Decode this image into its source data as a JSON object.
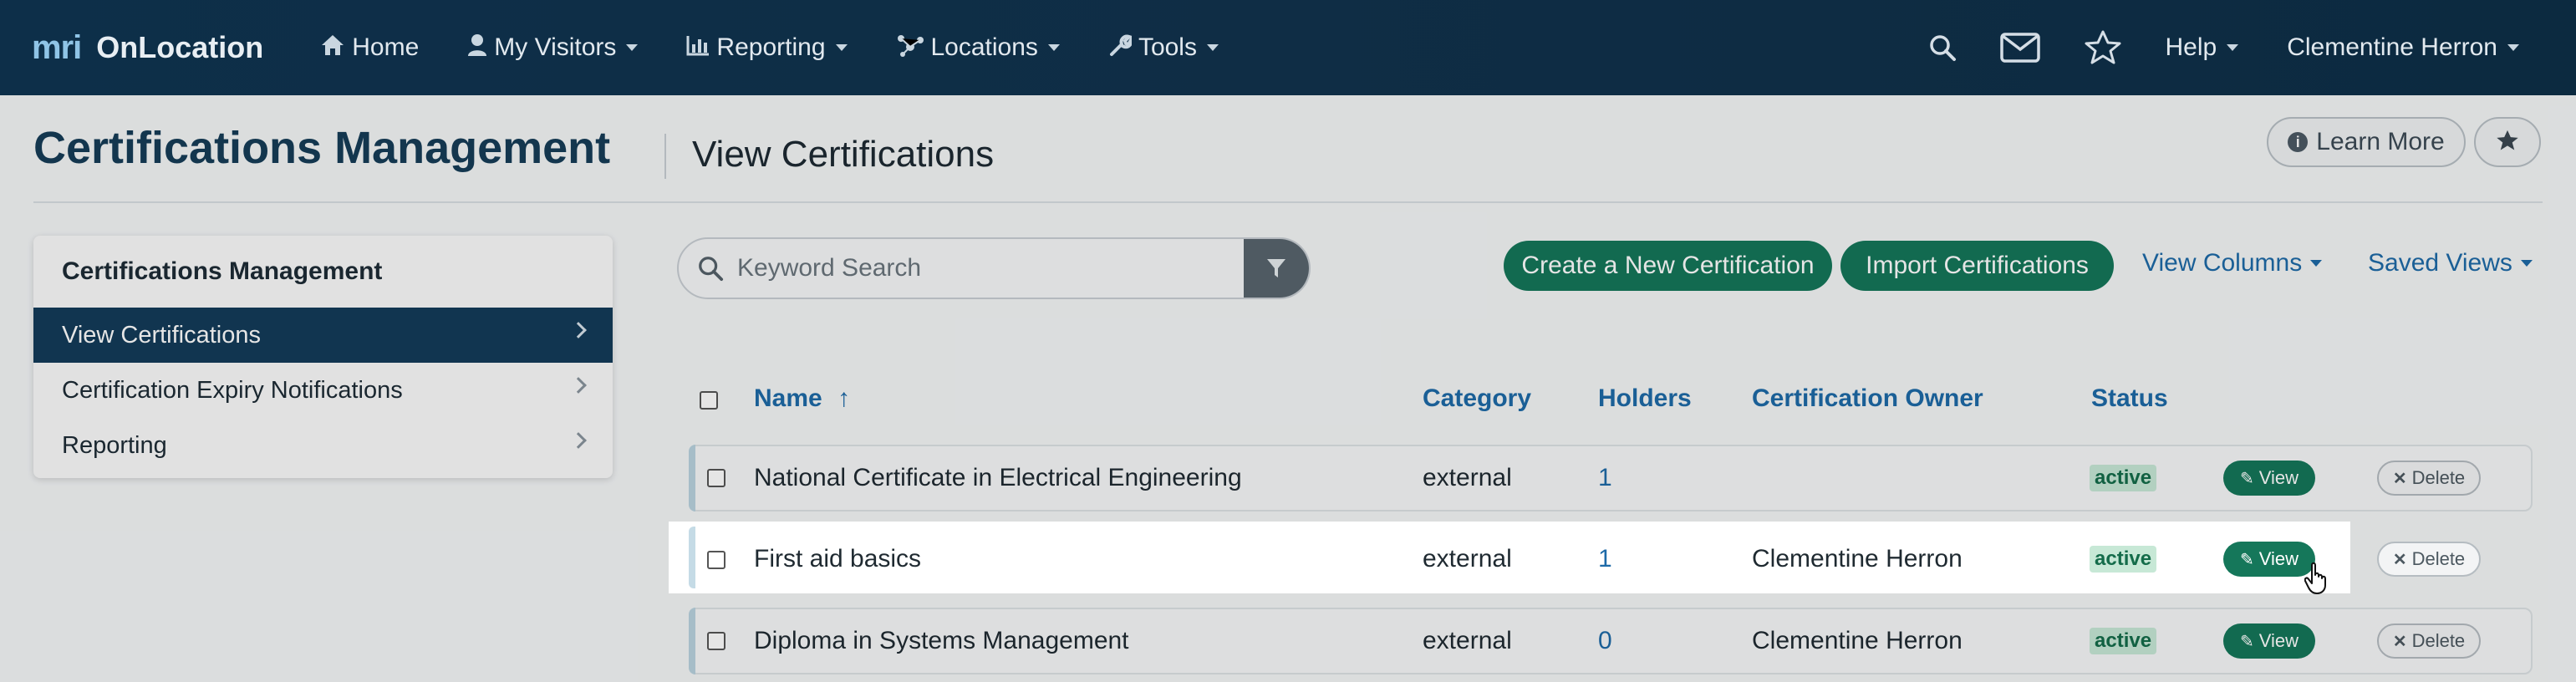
{
  "navbar": {
    "brand_mark": "mri",
    "brand_name": "OnLocation",
    "items": [
      {
        "label": "Home",
        "icon": "home-icon"
      },
      {
        "label": "My Visitors",
        "icon": "user-icon"
      },
      {
        "label": "Reporting",
        "icon": "bar-chart-icon"
      },
      {
        "label": "Locations",
        "icon": "network-icon"
      },
      {
        "label": "Tools",
        "icon": "wrench-icon"
      }
    ],
    "help_label": "Help",
    "user_name": "Clementine Herron"
  },
  "page": {
    "title": "Certifications Management",
    "subtitle": "View Certifications",
    "learn_more_label": "Learn More"
  },
  "sidebar": {
    "heading": "Certifications Management",
    "items": [
      {
        "label": "View Certifications",
        "active": true
      },
      {
        "label": "Certification Expiry Notifications",
        "active": false
      },
      {
        "label": "Reporting",
        "active": false
      }
    ]
  },
  "toolbar": {
    "search_placeholder": "Keyword Search",
    "create_label": "Create a New Certification",
    "import_label": "Import Certifications",
    "view_columns_label": "View Columns",
    "saved_views_label": "Saved Views"
  },
  "table": {
    "columns": {
      "name": "Name",
      "sort_indicator": "↑",
      "category": "Category",
      "holders": "Holders",
      "owner": "Certification Owner",
      "status": "Status"
    },
    "view_label": "View",
    "delete_label": "Delete",
    "rows": [
      {
        "name": "National Certificate in Electrical Engineering",
        "category": "external",
        "holders": "1",
        "owner": "",
        "status": "active"
      },
      {
        "name": "First aid basics",
        "category": "external",
        "holders": "1",
        "owner": "Clementine Herron",
        "status": "active"
      },
      {
        "name": "Diploma in Systems Management",
        "category": "external",
        "holders": "0",
        "owner": "Clementine Herron",
        "status": "active"
      }
    ]
  },
  "colors": {
    "navbar_bg": "#0f2d45",
    "accent_green": "#15775a",
    "link_blue": "#1d6aa8",
    "active_sidebar": "#143c5a"
  }
}
